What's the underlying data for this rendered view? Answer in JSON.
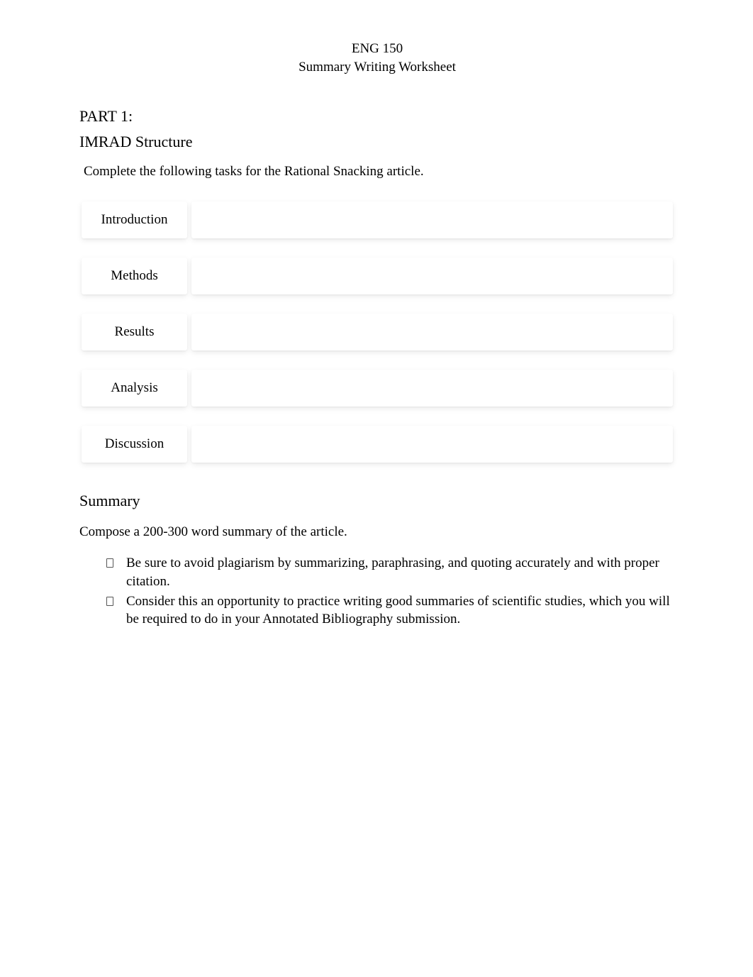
{
  "header": {
    "line1": "ENG 150",
    "line2": "Summary Writing Worksheet"
  },
  "part1": {
    "heading": "PART 1:",
    "subheading": "IMRAD Structure",
    "task": "Complete the following tasks for the Rational Snacking article.",
    "rows": [
      {
        "label": "Introduction",
        "content": ""
      },
      {
        "label": "Methods",
        "content": ""
      },
      {
        "label": "Results",
        "content": ""
      },
      {
        "label": "Analysis",
        "content": ""
      },
      {
        "label": "Discussion",
        "content": ""
      }
    ]
  },
  "summary": {
    "heading": "Summary",
    "instruction": "Compose a 200-300 word summary of the article.",
    "bullets": [
      "Be sure to avoid plagiarism by summarizing, paraphrasing, and quoting accurately and with proper citation.",
      "Consider this an opportunity to practice writing good summaries of scientific studies, which you will be required to do in your Annotated Bibliography submission."
    ]
  }
}
